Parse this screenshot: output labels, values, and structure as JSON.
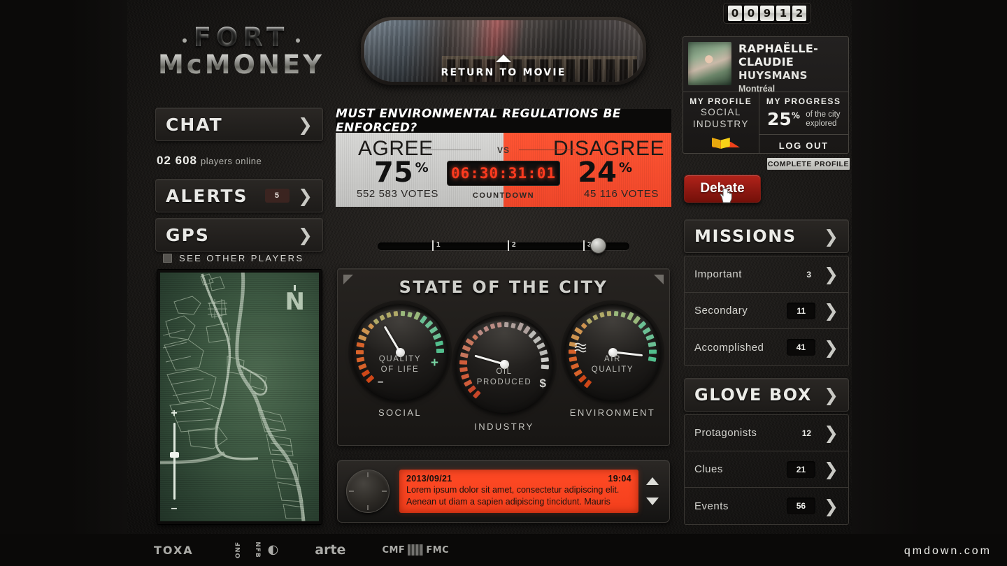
{
  "brand": {
    "line1": "FORT",
    "line2": "McMONEY"
  },
  "mirror": {
    "return_label": "RETURN TO MOVIE",
    "arrow_icon": "triangle-up-icon"
  },
  "counter": {
    "digits": [
      "0",
      "0",
      "9",
      "1",
      "2"
    ]
  },
  "sidebar": {
    "chat": {
      "label": "CHAT",
      "chevron": "❯"
    },
    "players_count": "02 608",
    "players_label": "players online",
    "alerts": {
      "label": "ALERTS",
      "badge": "5",
      "chevron": "❯"
    },
    "gps": {
      "label": "GPS",
      "chevron": "❯"
    },
    "see_other_players": "SEE OTHER PLAYERS",
    "map": {
      "compass": "N",
      "zoom_in": "+",
      "zoom_out": "–"
    }
  },
  "poll": {
    "question": "MUST ENVIRONMENTAL REGULATIONS BE ENFORCED?",
    "vs": "VS",
    "agree": {
      "title": "AGREE",
      "percent": "75",
      "percent_symbol": "%",
      "votes": "552 583 VOTES"
    },
    "disagree": {
      "title": "DISAGREE",
      "percent": "24",
      "percent_symbol": "%",
      "votes": "45  116 VOTES"
    },
    "countdown_value": "06:30:31:01",
    "countdown_label": "COUNTDOWN"
  },
  "slider": {
    "ticks": [
      "1",
      "2",
      "3"
    ],
    "value": 3
  },
  "state_of_city": {
    "title": "STATE OF THE CITY",
    "gauges": [
      {
        "name": "QUALITY\nOF LIFE",
        "line1": "QUALITY",
        "line2": "OF LIFE",
        "caption": "SOCIAL",
        "value": 38,
        "plus": "+",
        "minus": "–"
      },
      {
        "name": "OIL\nPRODUCED",
        "line1": "OIL",
        "line2": "PRODUCED",
        "caption": "INDUSTRY",
        "value": 22,
        "money": "$"
      },
      {
        "name": "AIR\nQUALITY",
        "line1": "AIR",
        "line2": "QUALITY",
        "caption": "ENVIRONMENT",
        "value": 86,
        "wave_icon": "waves-icon"
      }
    ]
  },
  "news": {
    "date": "2013/09/21",
    "time": "19:04",
    "line1": "Lorem ipsum dolor sit amet, consectetur adipiscing elit.",
    "line2": "Aenean ut diam a sapien adipiscing tincidunt. Mauris",
    "scroll_up_icon": "chevron-up-icon",
    "scroll_down_icon": "chevron-down-icon"
  },
  "profile": {
    "first_name": "RAPHAËLLE-CLAUDIE",
    "last_name": "HUYSMANS",
    "city": "Montréal",
    "my_profile_label": "MY PROFILE",
    "profile_tag1": "SOCIAL",
    "profile_tag2": "INDUSTRY",
    "my_progress_label": "MY PROGRESS",
    "progress_percent": "25",
    "progress_percent_symbol": "%",
    "progress_text1": "of the city",
    "progress_text2": "explored",
    "logout": "LOG OUT",
    "complete_profile": "COMPLETE PROFILE",
    "debate_button": "Debate"
  },
  "missions": {
    "title": "MISSIONS",
    "chevron": "❯",
    "rows": [
      {
        "label": "Important",
        "count": "3",
        "style": "plain"
      },
      {
        "label": "Secondary",
        "count": "11",
        "style": "box"
      },
      {
        "label": "Accomplished",
        "count": "41",
        "style": "box"
      }
    ]
  },
  "glove_box": {
    "title": "GLOVE BOX",
    "chevron": "❯",
    "rows": [
      {
        "label": "Protagonists",
        "count": "12",
        "style": "plain"
      },
      {
        "label": "Clues",
        "count": "21",
        "style": "box"
      },
      {
        "label": "Events",
        "count": "56",
        "style": "box"
      }
    ]
  },
  "footer": {
    "logos": [
      "TOXA",
      "ONF NFB",
      "arte",
      "CMF FMC"
    ],
    "watermark": "qmdown.com"
  },
  "colors": {
    "accent_red": "#f0421a",
    "agree_bg": "#d0d0ce",
    "disagree_bg": "#f8492a",
    "debate_red": "#9e1c14",
    "gauge_green": "#5fc896",
    "gauge_orange": "#e2662b",
    "map_green": "#3e5a43"
  }
}
